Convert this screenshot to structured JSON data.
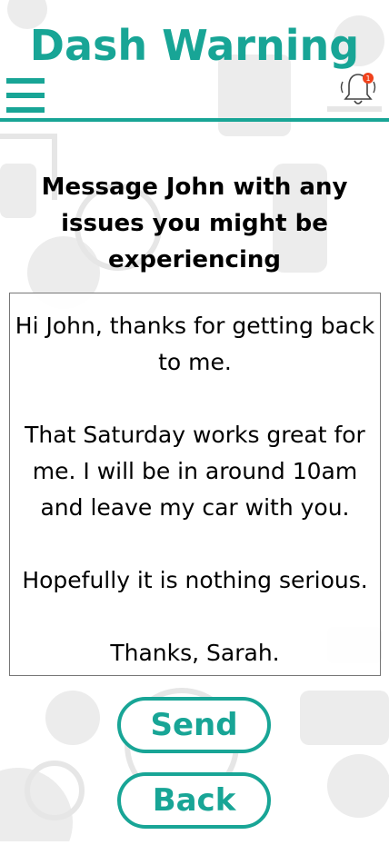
{
  "header": {
    "title": "Dash Warning",
    "notification_count": "1",
    "accent_color": "#18a596",
    "menu_icon": "hamburger-menu-icon",
    "bell_icon": "bell-icon"
  },
  "prompt": {
    "text": "Message John with any issues you might be experiencing"
  },
  "message": {
    "lines": [
      "Hi John, thanks for getting back to me.",
      "",
      "That Saturday works great for me. I will be in around 10am and leave my car with you.",
      "",
      "Hopefully it is nothing serious.",
      "",
      "Thanks, Sarah."
    ]
  },
  "actions": {
    "send_label": "Send",
    "back_label": "Back"
  }
}
